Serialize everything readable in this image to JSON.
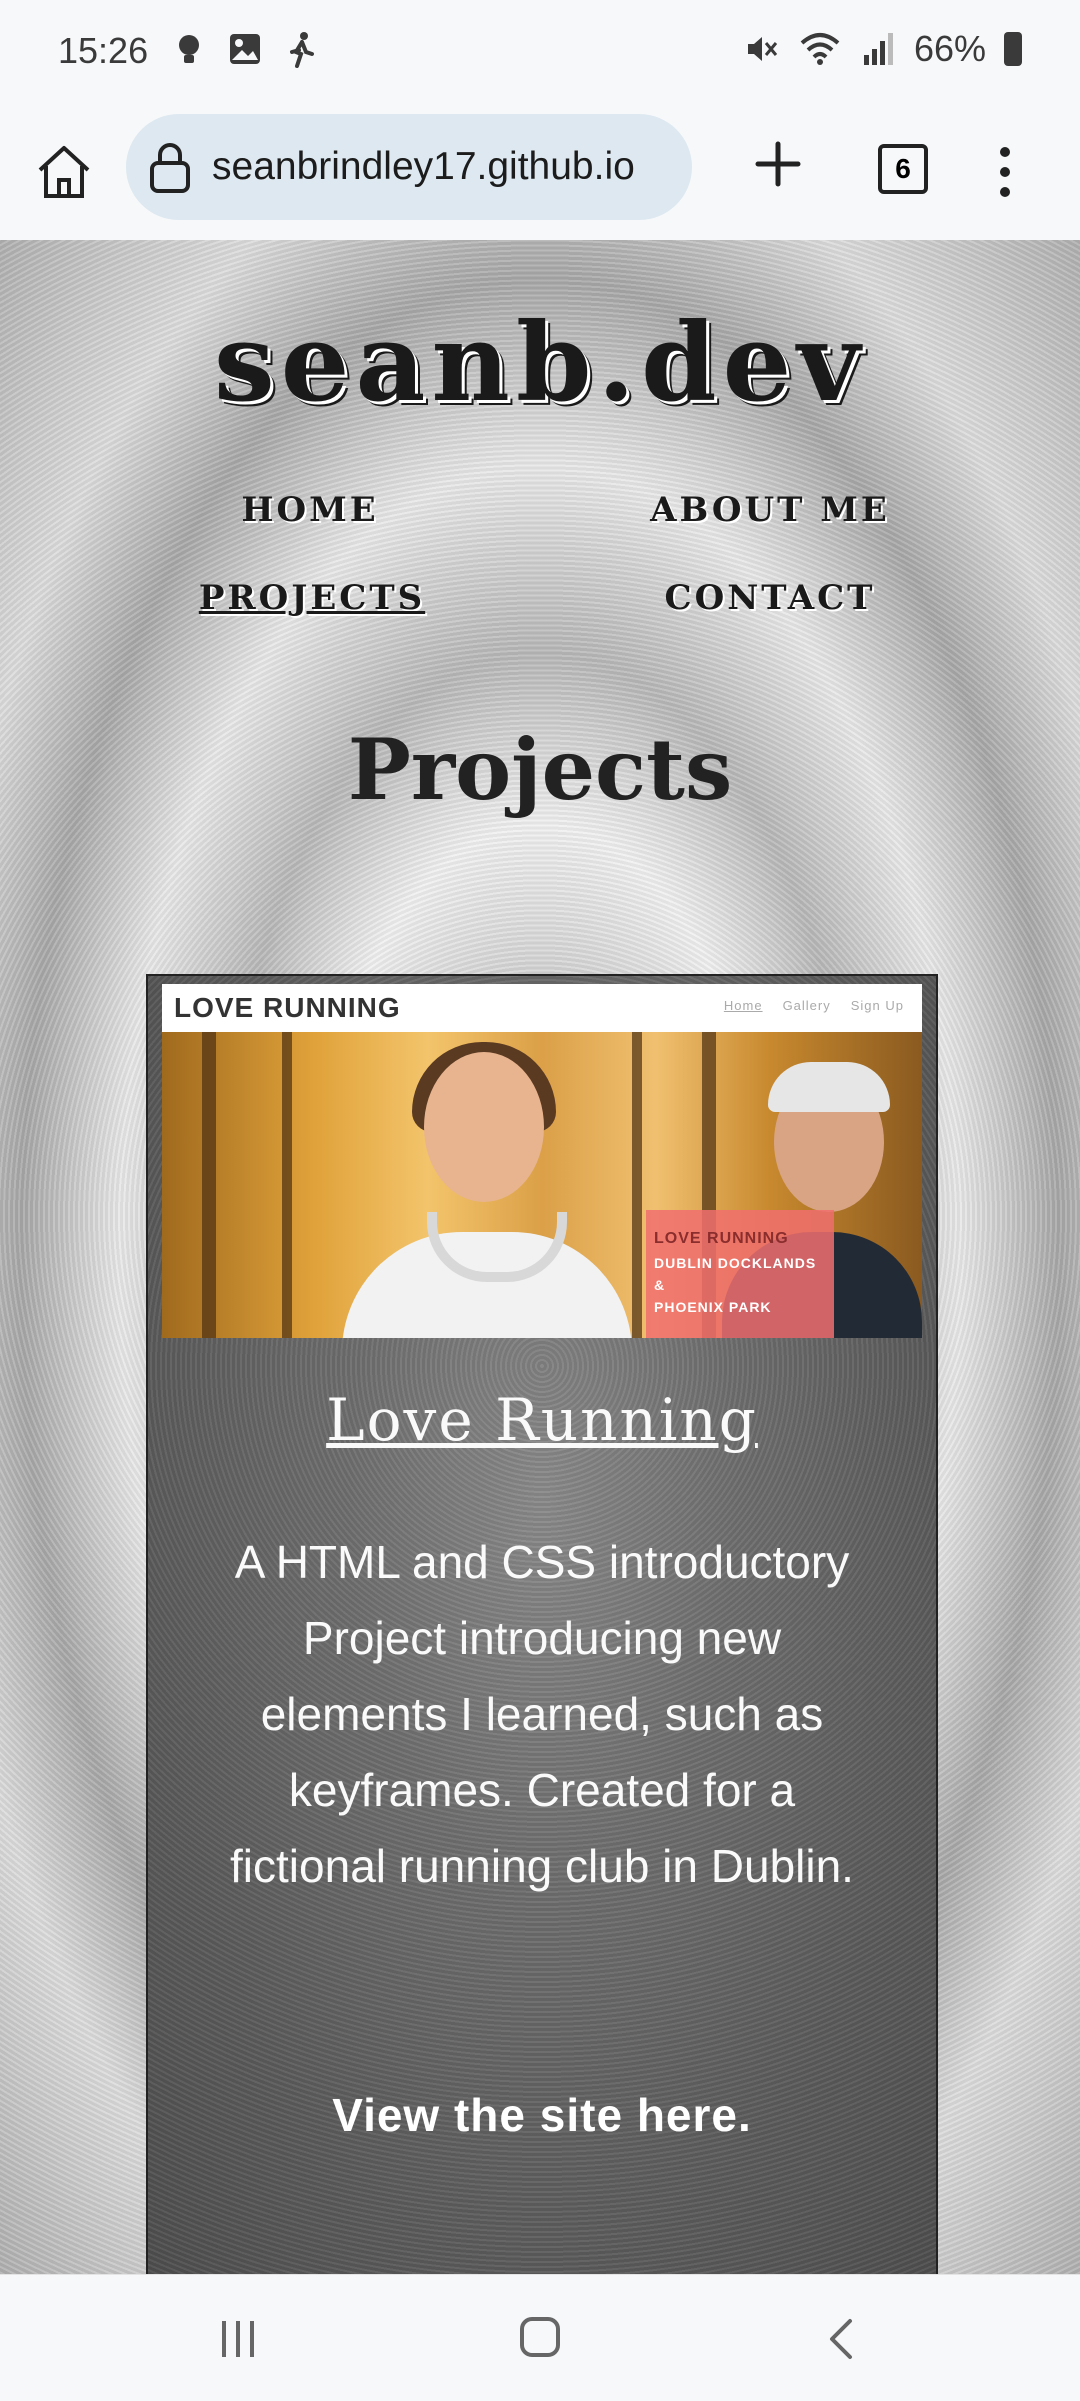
{
  "status_bar": {
    "time": "15:26",
    "battery": "66%",
    "left_icons": [
      "bulb-icon",
      "image-icon",
      "walking-icon"
    ],
    "right_icons": [
      "mute-icon",
      "wifi-icon",
      "signal-icon",
      "battery-icon"
    ]
  },
  "browser": {
    "url": "seanbrindley17.github.io",
    "tab_count": "6"
  },
  "site": {
    "title": "seanb.dev",
    "nav": {
      "home": "HOME",
      "about": "ABOUT ME",
      "projects": "PROJECTS",
      "contact": "CONTACT",
      "active": "PROJECTS"
    },
    "section_title": "Projects"
  },
  "project_card": {
    "thumbnail": {
      "logo": "LOVE RUNNING",
      "nav": [
        "Home",
        "Gallery",
        "Sign Up"
      ],
      "overlay_title": "LOVE RUNNING",
      "overlay_line1": "DUBLIN DOCKLANDS &",
      "overlay_line2": "PHOENIX PARK"
    },
    "title": "Love Running",
    "description": "A HTML and CSS introductory Project introducing new elements I learned, such as keyframes. Created for a fictional running club in Dublin.",
    "link_text": "View the site here."
  },
  "system_nav": {
    "icons": [
      "recent-apps-icon",
      "home-icon",
      "back-icon"
    ]
  }
}
